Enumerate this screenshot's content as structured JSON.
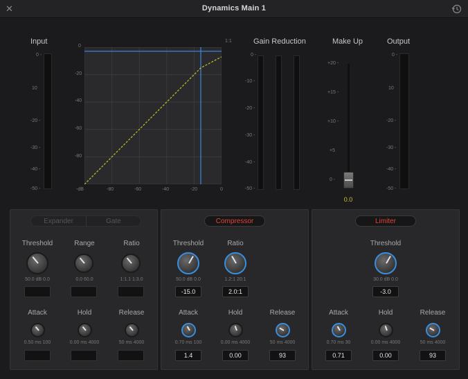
{
  "window": {
    "title": "Dynamics   Main 1",
    "close_icon": "close-icon",
    "reset_icon": "reset-icon"
  },
  "input": {
    "label": "Input",
    "ticks": [
      "0 -",
      "10",
      "-20 -",
      "-30 -",
      "-40 -",
      "-50 -"
    ]
  },
  "graph": {
    "y_ticks": [
      "0",
      "-20",
      "-40",
      "-60",
      "-80"
    ],
    "x_ticks": [
      "-dB",
      "-80",
      "-60",
      "-40",
      "-20",
      "0"
    ],
    "ratio_label": "1:1",
    "colors": {
      "curve": "#c9c428",
      "threshold": "#3b82d6"
    }
  },
  "gain_reduction": {
    "label": "Gain Reduction",
    "ticks": [
      "0 -",
      "-10 -",
      "-20 -",
      "-30 -",
      "-40 -",
      "-50 -"
    ]
  },
  "makeup": {
    "label": "Make Up",
    "ticks": [
      "+20 -",
      "+15 -",
      "+10 -",
      "+5",
      "0 -"
    ],
    "value": "0.0"
  },
  "output": {
    "label": "Output",
    "ticks": [
      "0 -",
      "10",
      "-20 -",
      "-30 -",
      "-40 -",
      "-50 -"
    ]
  },
  "expander": {
    "toggle_left": "Expander",
    "toggle_right": "Gate",
    "threshold": {
      "label": "Threshold",
      "min": "50.0",
      "unit": "dB",
      "max": "0.0",
      "value": ""
    },
    "range": {
      "label": "Range",
      "min": "0.0",
      "max": "60.0",
      "value": ""
    },
    "ratio": {
      "label": "Ratio",
      "min": "1:1.1",
      "max": "1:3.0",
      "value": ""
    },
    "attack": {
      "label": "Attack",
      "min": "0.50",
      "unit": "ms",
      "max": "100",
      "value": ""
    },
    "hold": {
      "label": "Hold",
      "min": "0.00",
      "unit": "ms",
      "max": "4000",
      "value": ""
    },
    "release": {
      "label": "Release",
      "min": "50",
      "unit": "ms",
      "max": "4000",
      "value": ""
    }
  },
  "compressor": {
    "toggle": "Compressor",
    "threshold": {
      "label": "Threshold",
      "min": "50.0",
      "unit": "dB",
      "max": "0.0",
      "value": "-15.0"
    },
    "ratio": {
      "label": "Ratio",
      "min": "1.2:1",
      "max": "20:1",
      "value": "2.0:1"
    },
    "attack": {
      "label": "Attack",
      "min": "0.70",
      "unit": "ms",
      "max": "100",
      "value": "1.4"
    },
    "hold": {
      "label": "Hold",
      "min": "0.00",
      "unit": "ms",
      "max": "4000",
      "value": "0.00"
    },
    "release": {
      "label": "Release",
      "min": "50",
      "unit": "ms",
      "max": "4000",
      "value": "93"
    }
  },
  "limiter": {
    "toggle": "Limiter",
    "threshold": {
      "label": "Threshold",
      "min": "30.0",
      "unit": "dB",
      "max": "0.0",
      "value": "-3.0"
    },
    "attack": {
      "label": "Attack",
      "min": "0.70",
      "unit": "ms",
      "max": "30",
      "value": "0.71"
    },
    "hold": {
      "label": "Hold",
      "min": "0.00",
      "unit": "ms",
      "max": "4000",
      "value": "0.00"
    },
    "release": {
      "label": "Release",
      "min": "50",
      "unit": "ms",
      "max": "4000",
      "value": "93"
    }
  }
}
